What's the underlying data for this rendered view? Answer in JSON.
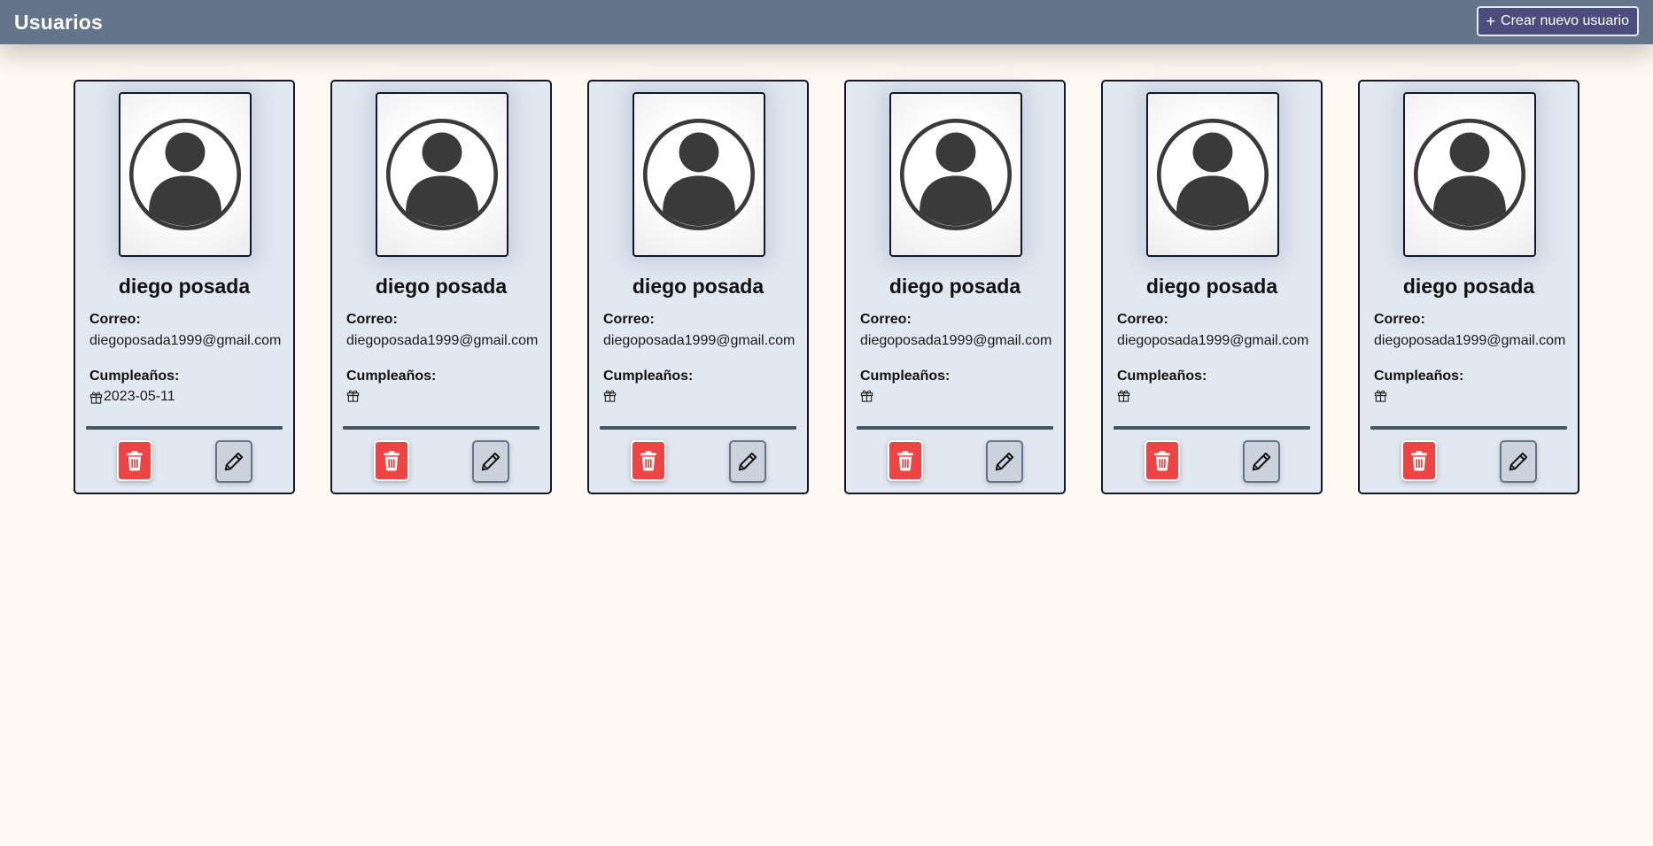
{
  "header": {
    "title": "Usuarios",
    "create_button": {
      "icon": "plus-icon",
      "label": "Crear nuevo usuario"
    }
  },
  "labels": {
    "email": "Correo:",
    "birthday": "Cumpleaños:"
  },
  "colors": {
    "header_bg": "#64748b",
    "card_bg": "#e2e8f0",
    "delete_button": "#ef4444",
    "edit_button": "#cbd2db",
    "page_bg": "#fef9f3"
  },
  "users": [
    {
      "name": "diego posada",
      "email": "diegoposada1999@gmail.com",
      "birthday": "2023-05-11",
      "avatar_icon": "user-avatar-icon",
      "birthday_icon": "gift-icon",
      "delete_icon": "trash-icon",
      "edit_icon": "pencil-icon"
    },
    {
      "name": "diego posada",
      "email": "diegoposada1999@gmail.com",
      "birthday": "",
      "avatar_icon": "user-avatar-icon",
      "birthday_icon": "gift-icon",
      "delete_icon": "trash-icon",
      "edit_icon": "pencil-icon"
    },
    {
      "name": "diego posada",
      "email": "diegoposada1999@gmail.com",
      "birthday": "",
      "avatar_icon": "user-avatar-icon",
      "birthday_icon": "gift-icon",
      "delete_icon": "trash-icon",
      "edit_icon": "pencil-icon"
    },
    {
      "name": "diego posada",
      "email": "diegoposada1999@gmail.com",
      "birthday": "",
      "avatar_icon": "user-avatar-icon",
      "birthday_icon": "gift-icon",
      "delete_icon": "trash-icon",
      "edit_icon": "pencil-icon"
    },
    {
      "name": "diego posada",
      "email": "diegoposada1999@gmail.com",
      "birthday": "",
      "avatar_icon": "user-avatar-icon",
      "birthday_icon": "gift-icon",
      "delete_icon": "trash-icon",
      "edit_icon": "pencil-icon"
    },
    {
      "name": "diego posada",
      "email": "diegoposada1999@gmail.com",
      "birthday": "",
      "avatar_icon": "user-avatar-icon",
      "birthday_icon": "gift-icon",
      "delete_icon": "trash-icon",
      "edit_icon": "pencil-icon"
    }
  ]
}
